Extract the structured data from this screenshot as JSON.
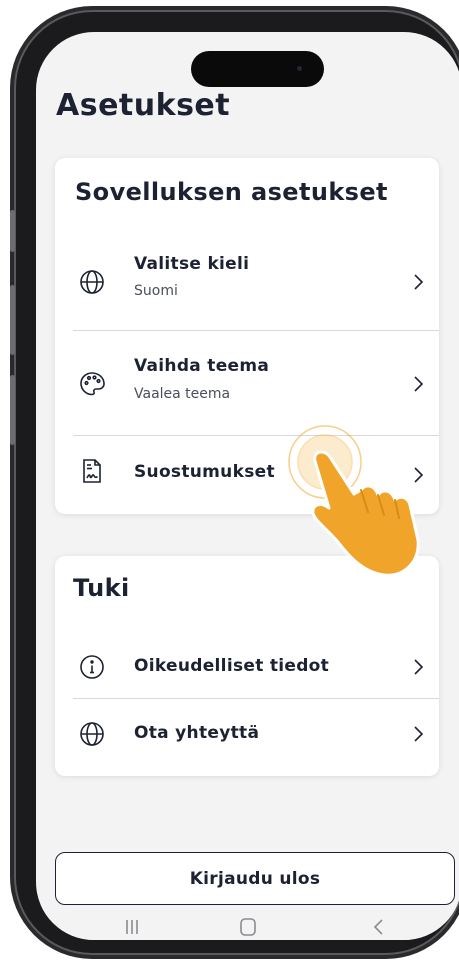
{
  "page": {
    "title": "Asetukset"
  },
  "app_settings": {
    "title": "Sovelluksen asetukset",
    "items": [
      {
        "label": "Valitse kieli",
        "sublabel": "Suomi",
        "icon": "globe-icon"
      },
      {
        "label": "Vaihda teema",
        "sublabel": "Vaalea teema",
        "icon": "palette-icon"
      },
      {
        "label": "Suostumukset",
        "icon": "document-signature-icon"
      }
    ]
  },
  "support": {
    "title": "Tuki",
    "items": [
      {
        "label": "Oikeudelliset tiedot",
        "icon": "info-icon"
      },
      {
        "label": "Ota yhteyttä",
        "icon": "globe-icon"
      }
    ]
  },
  "logout": {
    "label": "Kirjaudu ulos"
  },
  "android_nav": {
    "icons": [
      "recents-icon",
      "home-icon",
      "back-icon"
    ]
  },
  "colors": {
    "text": "#1d2233",
    "background": "#f3f3f4",
    "card": "#ffffff",
    "hand": "#f0a52a"
  }
}
